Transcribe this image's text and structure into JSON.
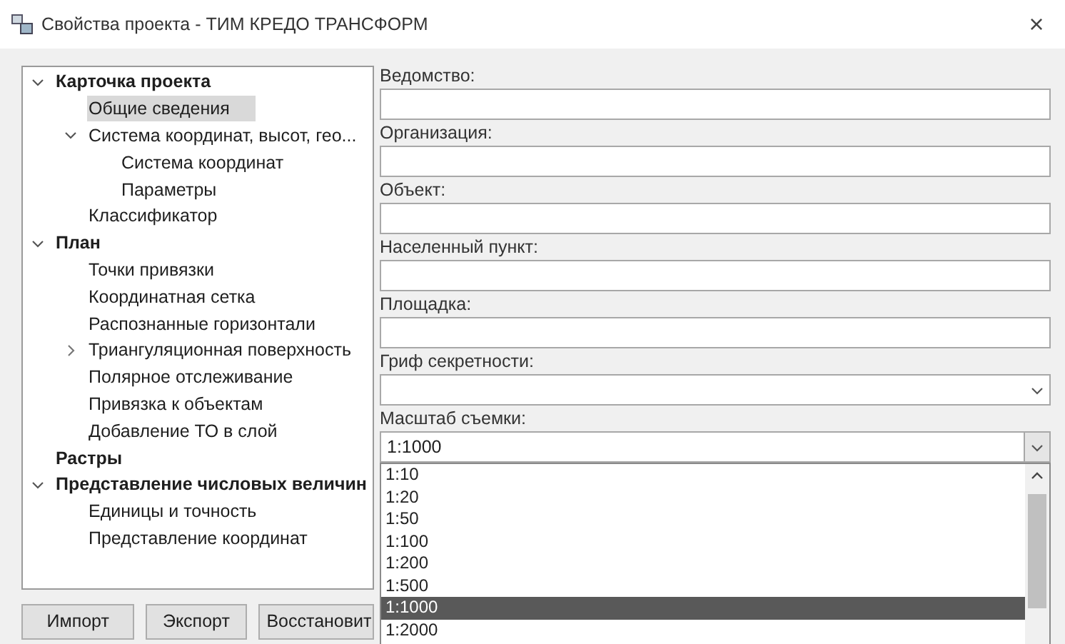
{
  "window": {
    "title": "Свойства проекта - ТИМ КРЕДО ТРАНСФОРМ",
    "close": "×"
  },
  "tree": [
    {
      "label": "Карточка проекта",
      "expanded": true,
      "selected": false,
      "children": [
        {
          "label": "Общие сведения",
          "selected": true
        },
        {
          "label": "Система координат, высот, гео...",
          "expanded": true,
          "selected": false,
          "children": [
            {
              "label": "Система координат",
              "selected": false
            },
            {
              "label": "Параметры",
              "selected": false
            }
          ]
        },
        {
          "label": "Классификатор",
          "selected": false
        }
      ]
    },
    {
      "label": "План",
      "expanded": true,
      "selected": false,
      "children": [
        {
          "label": "Точки привязки",
          "selected": false
        },
        {
          "label": "Координатная сетка",
          "selected": false
        },
        {
          "label": "Распознанные горизонтали",
          "selected": false
        },
        {
          "label": "Триангуляционная поверхность",
          "expanded": false,
          "selected": false
        },
        {
          "label": "Полярное отслеживание",
          "selected": false
        },
        {
          "label": "Привязка к объектам",
          "selected": false
        },
        {
          "label": "Добавление ТО в слой",
          "selected": false
        }
      ]
    },
    {
      "label": "Растры",
      "selected": false
    },
    {
      "label": "Представление числовых величин",
      "expanded": true,
      "selected": false,
      "children": [
        {
          "label": "Единицы и точность",
          "selected": false
        },
        {
          "label": "Представление координат",
          "selected": false
        }
      ]
    }
  ],
  "fields": [
    {
      "label": "Ведомство:",
      "kind": "text"
    },
    {
      "label": "Организация:",
      "kind": "text"
    },
    {
      "label": "Объект:",
      "kind": "text"
    },
    {
      "label": "Населенный пункт:",
      "kind": "text"
    },
    {
      "label": "Площадка:",
      "kind": "text"
    },
    {
      "label": "Гриф секретности:",
      "kind": "select",
      "open": false
    },
    {
      "label": "Масштаб съемки:",
      "kind": "select",
      "value": "1:1000",
      "open": true,
      "options": [
        {
          "label": "1:10",
          "selected": false
        },
        {
          "label": "1:20",
          "selected": false
        },
        {
          "label": "1:50",
          "selected": false
        },
        {
          "label": "1:100",
          "selected": false
        },
        {
          "label": "1:200",
          "selected": false
        },
        {
          "label": "1:500",
          "selected": false
        },
        {
          "label": "1:1000",
          "selected": true
        },
        {
          "label": "1:2000",
          "selected": false
        }
      ]
    }
  ],
  "buttons": [
    "Импорт",
    "Экспорт",
    "Восстановит"
  ]
}
